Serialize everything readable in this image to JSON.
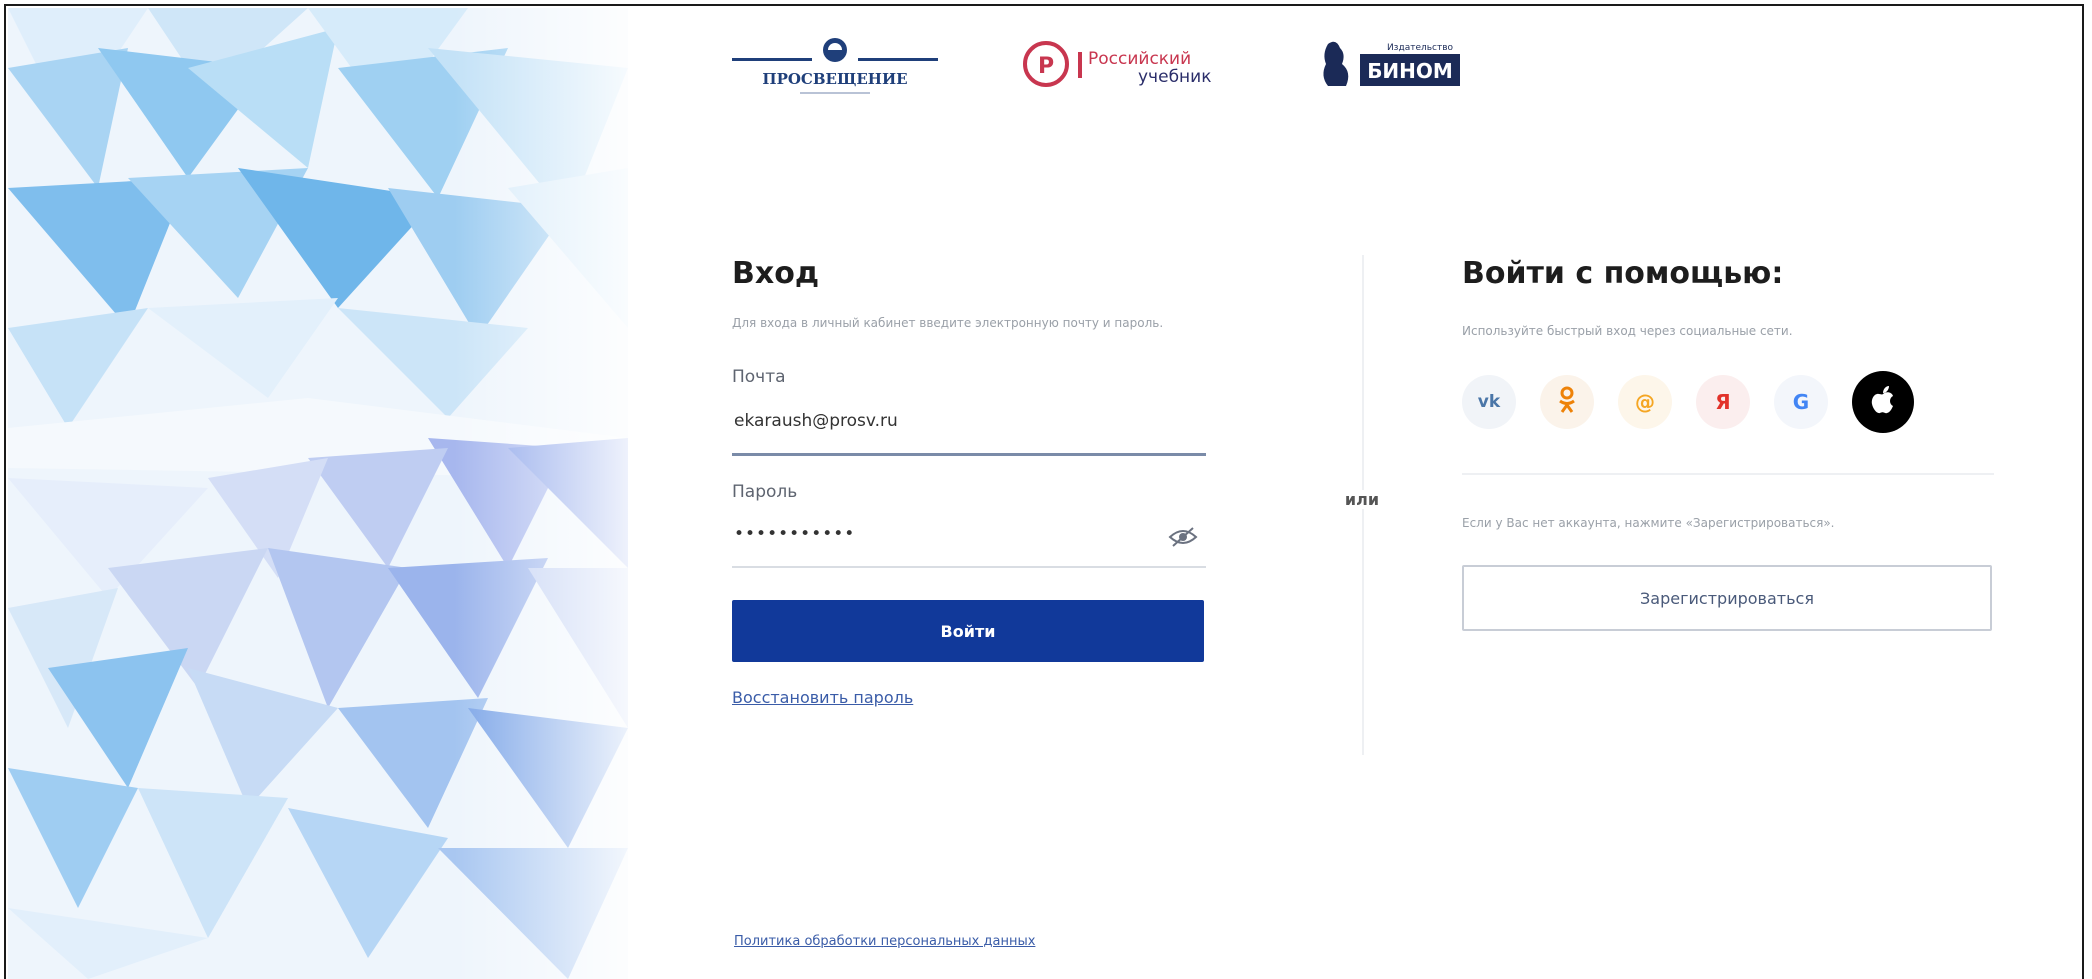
{
  "brands": {
    "prosvescheniye": "ПРОСВЕЩЕНИЕ",
    "rossiyskiy_top": "Российский",
    "rossiyskiy_bottom": "учебник",
    "binom_small": "Издательство",
    "binom": "БИНОМ"
  },
  "login": {
    "title": "Вход",
    "description": "Для входа в личный кабинет введите электронную почту и пароль.",
    "email_label": "Почта",
    "email_value": "ekaraush@prosv.ru",
    "password_label": "Пароль",
    "password_value": "•••••••••••",
    "submit_label": "Войти",
    "restore_link": "Восстановить пароль"
  },
  "separator": "или",
  "social": {
    "title": "Войти с помощью:",
    "description": "Используйте быстрый вход через социальные сети.",
    "providers": [
      {
        "name": "vk",
        "glyph": "vk",
        "color": "#4a76a8",
        "bg": "#f1f4f8"
      },
      {
        "name": "odnoklassniki",
        "glyph": "ok",
        "color": "#ee8208",
        "bg": "#fbf3ea"
      },
      {
        "name": "mailru",
        "glyph": "@",
        "color": "#f5a623",
        "bg": "#fdf6ea"
      },
      {
        "name": "yandex",
        "glyph": "Я",
        "color": "#e2322a",
        "bg": "#fbeeee"
      },
      {
        "name": "google",
        "glyph": "G",
        "color": "#4285f4",
        "bg": "#f3f6fb"
      },
      {
        "name": "apple",
        "glyph": "",
        "color": "#ffffff",
        "bg": "#000000"
      }
    ],
    "register_hint": "Если у Вас нет аккаунта, нажмите «Зарегистрироваться».",
    "register_button": "Зарегистрироваться"
  },
  "footer": {
    "policy_link": "Политика обработки персональных данных"
  },
  "colors": {
    "primary": "#11399a",
    "link": "#3a5ca8"
  }
}
